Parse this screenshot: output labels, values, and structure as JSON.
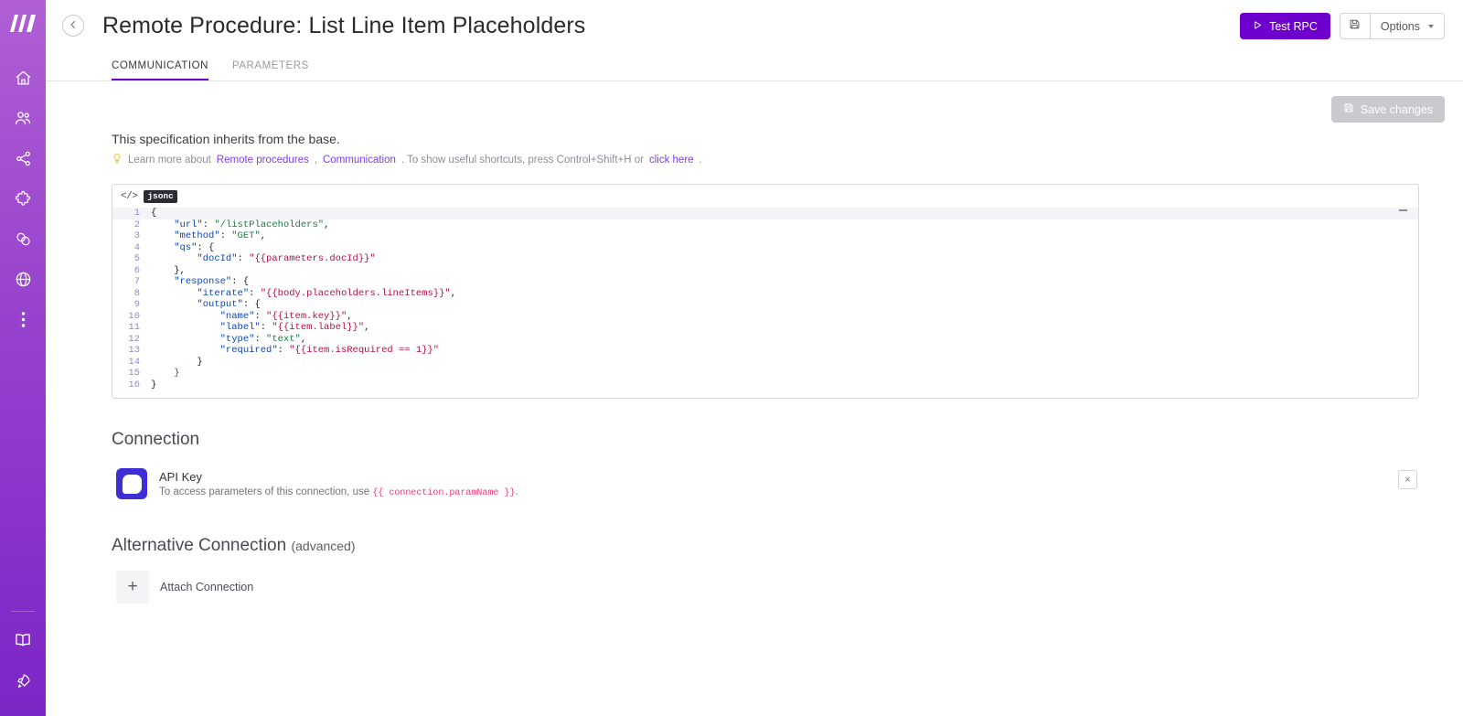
{
  "sidebar": {
    "logo_name": "make-logo",
    "items": [
      {
        "name": "home-icon",
        "label": "Home"
      },
      {
        "name": "team-icon",
        "label": "Team"
      },
      {
        "name": "scenarios-share-icon",
        "label": "Scenarios"
      },
      {
        "name": "puzzle-apps-icon",
        "label": "Apps"
      },
      {
        "name": "connections-link-icon",
        "label": "Connections"
      },
      {
        "name": "globe-icon",
        "label": "Webhooks"
      },
      {
        "name": "more-dots-icon",
        "label": "More"
      }
    ],
    "bottom_items": [
      {
        "name": "documentation-book-icon",
        "label": "Documentation"
      },
      {
        "name": "rocket-icon",
        "label": "What's new"
      }
    ]
  },
  "header": {
    "back_label": "Back",
    "title": "Remote Procedure: List Line Item Placeholders",
    "test_rpc_label": "Test RPC",
    "options_label": "Options",
    "save_icon_name": "floppy-disk-icon"
  },
  "tabs": [
    {
      "label": "Communication",
      "active": true
    },
    {
      "label": "Parameters",
      "active": false
    }
  ],
  "main": {
    "save_changes_label": "Save changes",
    "spec_text": "This specification inherits from the base.",
    "hint": {
      "prefix": "Learn more about ",
      "link1": "Remote procedures",
      "sep1": ", ",
      "link2": "Communication",
      "middle": ". To show useful shortcuts, press Control+Shift+H or ",
      "link3": "click here",
      "suffix": "."
    }
  },
  "editor": {
    "lang_badge": "jsonc",
    "code_icon_label": "</>",
    "lines": [
      {
        "n": "1",
        "indent": 0,
        "tokens": [
          {
            "t": "{",
            "c": "p"
          }
        ],
        "highlight": true
      },
      {
        "n": "2",
        "indent": 1,
        "tokens": [
          {
            "t": "\"url\"",
            "c": "k"
          },
          {
            "t": ": ",
            "c": "p"
          },
          {
            "t": "\"/listPlaceholders\"",
            "c": "v"
          },
          {
            "t": ",",
            "c": "p"
          }
        ]
      },
      {
        "n": "3",
        "indent": 1,
        "tokens": [
          {
            "t": "\"method\"",
            "c": "k"
          },
          {
            "t": ": ",
            "c": "p"
          },
          {
            "t": "\"GET\"",
            "c": "v"
          },
          {
            "t": ",",
            "c": "p"
          }
        ]
      },
      {
        "n": "4",
        "indent": 1,
        "tokens": [
          {
            "t": "\"qs\"",
            "c": "k"
          },
          {
            "t": ": {",
            "c": "p"
          }
        ]
      },
      {
        "n": "5",
        "indent": 2,
        "tokens": [
          {
            "t": "\"docId\"",
            "c": "k"
          },
          {
            "t": ": ",
            "c": "p"
          },
          {
            "t": "\"{{parameters.docId}}\"",
            "c": "s"
          }
        ]
      },
      {
        "n": "6",
        "indent": 1,
        "tokens": [
          {
            "t": "},",
            "c": "p"
          }
        ]
      },
      {
        "n": "7",
        "indent": 1,
        "tokens": [
          {
            "t": "\"response\"",
            "c": "k"
          },
          {
            "t": ": {",
            "c": "p"
          }
        ]
      },
      {
        "n": "8",
        "indent": 2,
        "tokens": [
          {
            "t": "\"iterate\"",
            "c": "k"
          },
          {
            "t": ": ",
            "c": "p"
          },
          {
            "t": "\"{{body.placeholders.lineItems}}\"",
            "c": "s"
          },
          {
            "t": ",",
            "c": "p"
          }
        ]
      },
      {
        "n": "9",
        "indent": 2,
        "tokens": [
          {
            "t": "\"output\"",
            "c": "k"
          },
          {
            "t": ": {",
            "c": "p"
          }
        ]
      },
      {
        "n": "10",
        "indent": 3,
        "tokens": [
          {
            "t": "\"name\"",
            "c": "k"
          },
          {
            "t": ": ",
            "c": "p"
          },
          {
            "t": "\"{{item.key}}\"",
            "c": "s"
          },
          {
            "t": ",",
            "c": "p"
          }
        ]
      },
      {
        "n": "11",
        "indent": 3,
        "tokens": [
          {
            "t": "\"label\"",
            "c": "k"
          },
          {
            "t": ": ",
            "c": "p"
          },
          {
            "t": "\"{{item.label}}\"",
            "c": "s"
          },
          {
            "t": ",",
            "c": "p"
          }
        ]
      },
      {
        "n": "12",
        "indent": 3,
        "tokens": [
          {
            "t": "\"type\"",
            "c": "k"
          },
          {
            "t": ": ",
            "c": "p"
          },
          {
            "t": "\"text\"",
            "c": "v"
          },
          {
            "t": ",",
            "c": "p"
          }
        ]
      },
      {
        "n": "13",
        "indent": 3,
        "tokens": [
          {
            "t": "\"required\"",
            "c": "k"
          },
          {
            "t": ": ",
            "c": "p"
          },
          {
            "t": "\"{{item.isRequired == 1}}\"",
            "c": "s"
          }
        ]
      },
      {
        "n": "14",
        "indent": 2,
        "tokens": [
          {
            "t": "}",
            "c": "p"
          }
        ]
      },
      {
        "n": "15",
        "indent": 1,
        "tokens": [
          {
            "t": "}",
            "c": "brace-g"
          }
        ]
      },
      {
        "n": "16",
        "indent": 0,
        "tokens": [
          {
            "t": "}",
            "c": "p"
          }
        ]
      }
    ]
  },
  "connection_section": {
    "title": "Connection",
    "item": {
      "name": "API Key",
      "desc_prefix": "To access parameters of this connection, use ",
      "desc_code": "{{ connection.paramName }}",
      "desc_suffix": ".",
      "remove_label": "×"
    }
  },
  "alt_connection_section": {
    "title": "Alternative Connection",
    "subtitle": "(advanced)",
    "attach_label": "Attach Connection",
    "plus_label": "+"
  },
  "colors": {
    "accent": "#6d00cc",
    "sidebar_top": "#b05fd4",
    "sidebar_bottom": "#7b26c6",
    "link": "#7b3fe4",
    "connection_icon": "#3d2fd4",
    "inline_code": "#e0457b"
  }
}
